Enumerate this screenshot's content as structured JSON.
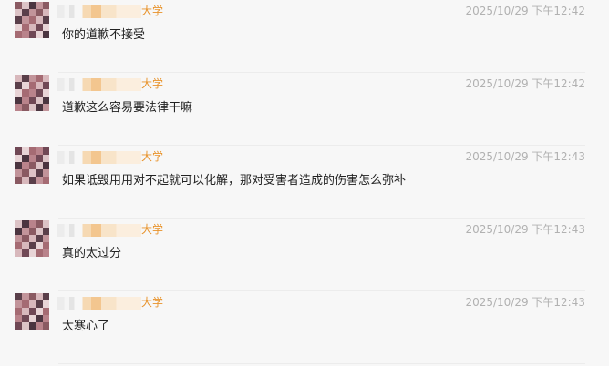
{
  "comments": [
    {
      "name_suffix": "大学",
      "time": "2025/10/29 下午12:42",
      "text": "你的道歉不接受"
    },
    {
      "name_suffix": "大学",
      "time": "2025/10/29 下午12:42",
      "text": "道歉这么容易要法律干嘛"
    },
    {
      "name_suffix": "大学",
      "time": "2025/10/29 下午12:43",
      "text": "如果诋毁用用对不起就可以化解，那对受害者造成的伤害怎么弥补"
    },
    {
      "name_suffix": "大学",
      "time": "2025/10/29 下午12:43",
      "text": "真的太过分"
    },
    {
      "name_suffix": "大学",
      "time": "2025/10/29 下午12:43",
      "text": "太寒心了"
    }
  ],
  "colors": {
    "username": "#e8932b",
    "timestamp": "#b1b1b1",
    "text": "#222222",
    "background": "#f7f7f7"
  }
}
